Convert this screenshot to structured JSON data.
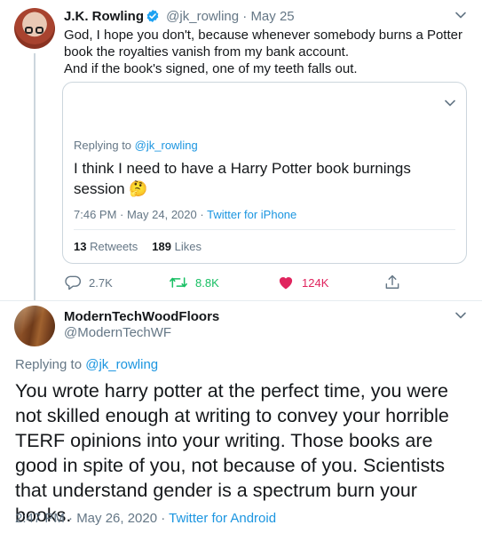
{
  "colors": {
    "accent": "#1b95e0",
    "secondary_text": "#657786",
    "primary_text": "#14171a",
    "border": "#ccd6dd",
    "retweet_green": "#17bf63",
    "like_red": "#e0245e"
  },
  "tweet1": {
    "author_name": "J.K. Rowling",
    "handle": "@jk_rowling",
    "separator": "·",
    "date": "May 25",
    "text_line1": "God, I hope you don't, because whenever somebody burns a Potter book the royalties vanish from my bank account.",
    "text_line2": "And if the book's signed, one of my teeth falls out.",
    "icons": {
      "verified": "verified-badge-icon",
      "more": "chevron-down-icon"
    },
    "quoted": {
      "replying_to_label": "Replying to",
      "replying_to_handle": "@jk_rowling",
      "text": "I think I need to have a Harry Potter book burnings session",
      "emoji": "🤔",
      "timestamp": "7:46 PM · May 24, 2020",
      "separator": "·",
      "source": "Twitter for iPhone",
      "retweets_count": "13",
      "retweets_label": "Retweets",
      "likes_count": "189",
      "likes_label": "Likes"
    },
    "actions": {
      "replies": "2.7K",
      "retweets": "8.8K",
      "likes": "124K"
    }
  },
  "tweet2": {
    "author_name": "ModernTechWoodFloors",
    "handle": "@ModernTechWF",
    "replying_to_label": "Replying to",
    "replying_to_handle": "@jk_rowling",
    "text": "You wrote harry potter at the perfect time, you were not skilled enough at writing to convey your horrible TERF opinions into your writing. Those books are good in spite of you, not because of you. Scientists that understand gender is a spectrum burn your books.",
    "timestamp": "2:47 PM · May 26, 2020",
    "separator": "·",
    "source": "Twitter for Android"
  }
}
